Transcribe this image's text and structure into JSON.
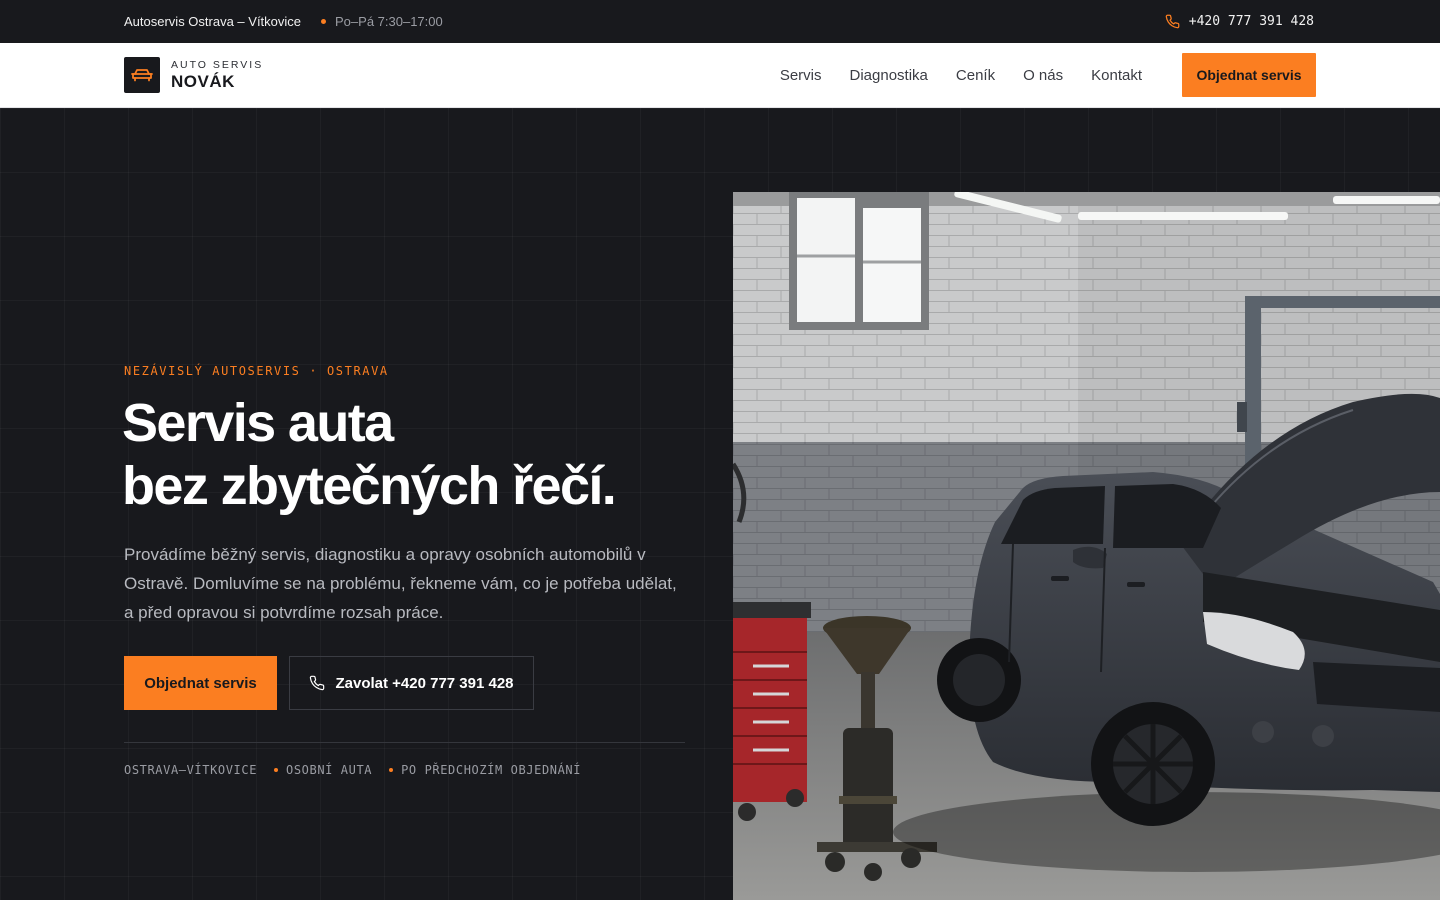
{
  "topbar": {
    "business": "Autoservis Ostrava – Vítkovice",
    "hours": "Po–Pá 7:30–17:00",
    "phone": "+420 777 391 428",
    "accent_color": "#fb7e21"
  },
  "nav": {
    "logo_top": "AUTO SERVIS",
    "logo_name": "NOVÁK",
    "logo_icon": "car-icon",
    "items": [
      "Servis",
      "Diagnostika",
      "Ceník",
      "O nás",
      "Kontakt"
    ],
    "cta": "Objednat servis"
  },
  "hero": {
    "eyebrow": "NEZÁVISLÝ AUTOSERVIS · OSTRAVA",
    "headline_line1": "Servis auta",
    "headline_line2": "bez zbytečných řečí.",
    "lead": "Provádíme běžný servis, diagnostiku a opravy osobních automobilů v Ostravě. Domluvíme se na problému, řekneme vám, co je potřeba udělat, a před opravou si potvrdíme rozsah práce.",
    "primary_button": "Objednat servis",
    "secondary_button": "Zavolat +420 777 391 428",
    "tags": [
      "OSTRAVA–VÍTKOVICE",
      "OSOBNÍ AUTA",
      "PO PŘEDCHOZÍM OBJEDNÁNÍ"
    ],
    "image_subject": "garage-photo-car-open-hood"
  }
}
